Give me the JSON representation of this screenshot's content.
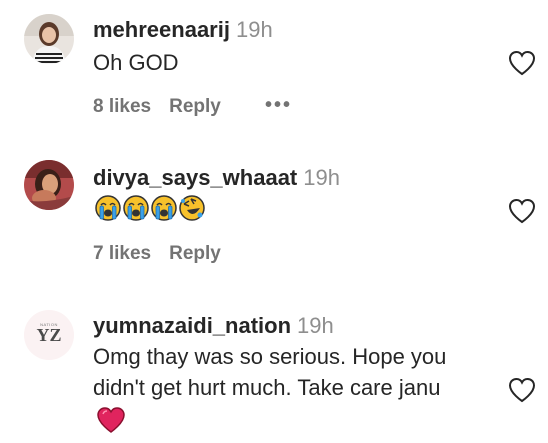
{
  "comments": [
    {
      "username": "mehreenaarij",
      "time": "19h",
      "text": "Oh GOD",
      "likes": "8 likes",
      "reply": "Reply",
      "more": "•••"
    },
    {
      "username": "divya_says_whaaat",
      "time": "19h",
      "emojis": [
        "loudly-crying-face",
        "loudly-crying-face",
        "loudly-crying-face",
        "rolling-on-floor-laughing"
      ],
      "likes": "7 likes",
      "reply": "Reply"
    },
    {
      "username": "yumnazaidi_nation",
      "time": "19h",
      "text_line1": "Omg thay was so serious. Hope you",
      "text_line2": "didn't get hurt much. Take care janu",
      "trailing_emoji": "red-heart",
      "avatar_logo": "YZ",
      "avatar_logo_sub": "NATION"
    }
  ],
  "colors": {
    "text": "#262626",
    "secondary": "#737373",
    "time": "#8e8e8e",
    "heart_red": "#e0245e"
  }
}
